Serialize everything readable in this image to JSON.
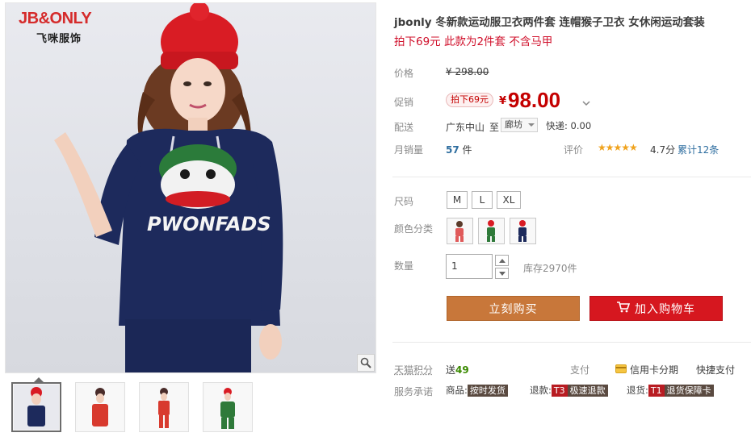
{
  "gallery": {
    "brand_line1": "JB&ONLY",
    "brand_line2": "飞咪服饰",
    "thumbnails": [
      "navy set",
      "red set",
      "red set alt",
      "green set"
    ],
    "zoom_icon": "search-icon"
  },
  "product": {
    "title": "jbonly 冬新款运动服卫衣两件套 连帽猴子卫衣 女休闲运动套装",
    "subtitle": "拍下69元 此款为2件套 不含马甲"
  },
  "price": {
    "label": "价格",
    "original": "¥ 298.00"
  },
  "promo": {
    "label": "促销",
    "tag": "拍下69元",
    "currency": "¥",
    "price": "98.00"
  },
  "shipping": {
    "label": "配送",
    "from": "广东中山",
    "to_prefix": "至",
    "dest": "廊坊",
    "fee": "快递: 0.00"
  },
  "sales": {
    "label": "月销量",
    "count": "57",
    "unit": " 件",
    "review_label": "评价",
    "stars": "★★★★★",
    "rating": "4.7分",
    "review_count": "累计12条"
  },
  "size": {
    "label": "尺码",
    "options": [
      "M",
      "L",
      "XL"
    ]
  },
  "color": {
    "label": "颜色分类",
    "options": [
      "red",
      "green",
      "navy"
    ]
  },
  "quantity": {
    "label": "数量",
    "value": "1",
    "stock": "库存2970件"
  },
  "actions": {
    "buy_now": "立刻购买",
    "add_to_cart": "加入购物车"
  },
  "service": {
    "points_label": "天猫积分",
    "points_prefix": "送",
    "points_value": "49",
    "pay_label": "支付",
    "pay_card": "信用卡分期",
    "pay_quick": "快捷支付",
    "promise_label": "服务承诺",
    "goods_label": "商品:",
    "goods_badge": "按时发货",
    "refund_label": "退款:",
    "refund_code": "T3",
    "refund_badge": "极速退款",
    "return_label": "退货:",
    "return_code": "T1",
    "return_badge": "退货保障卡"
  },
  "colors": {
    "price_red": "#c40000",
    "buy_orange": "#c8773a",
    "cart_red": "#d6171f",
    "link_blue": "#2d6d9f",
    "star_gold": "#f0a31e"
  }
}
